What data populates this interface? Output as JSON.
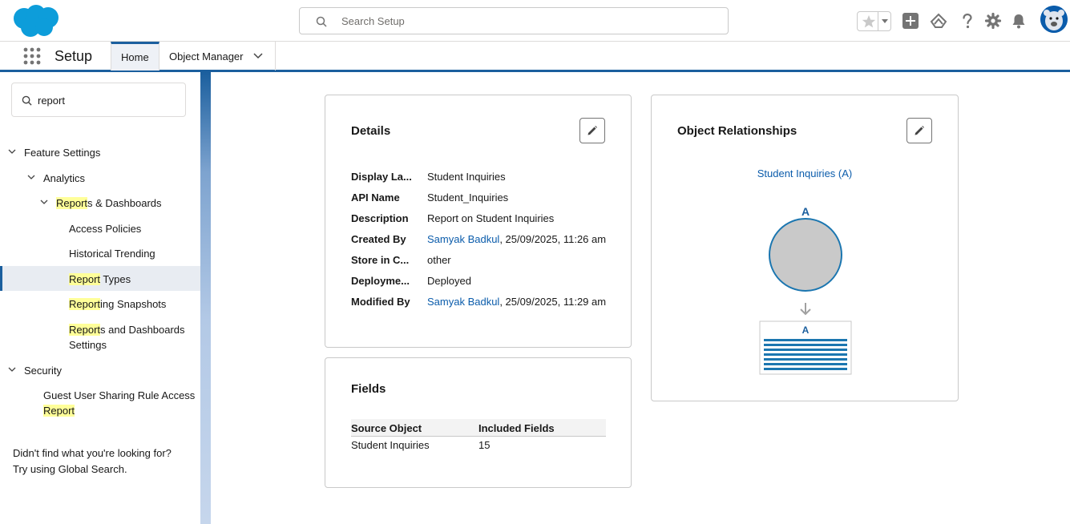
{
  "header": {
    "search_placeholder": "Search Setup"
  },
  "nav": {
    "app_name": "Setup",
    "tabs": [
      {
        "label": "Home",
        "active": true
      },
      {
        "label": "Object Manager",
        "active": false
      }
    ]
  },
  "sidebar": {
    "quickfind_value": "report",
    "tree": {
      "feature_settings": "Feature Settings",
      "analytics": "Analytics",
      "reports_dashboards": {
        "highlight": "Report",
        "rest": "s & Dashboards"
      },
      "access_policies": "Access Policies",
      "historical_trending": "Historical Trending",
      "report_types": {
        "highlight": "Report",
        "rest": " Types"
      },
      "reporting_snapshots": {
        "highlight": "Report",
        "rest": "ing Snapshots"
      },
      "reports_dash_settings": {
        "highlight": "Report",
        "rest_line1": "s and Dashboards",
        "line2": "Settings"
      },
      "security": "Security",
      "guest_user": {
        "line1": "Guest User Sharing Rule Access",
        "highlight": "Report"
      }
    },
    "help_line1": "Didn't find what you're looking for?",
    "help_line2": "Try using Global Search."
  },
  "details": {
    "title": "Details",
    "rows": [
      {
        "label": "Display La...",
        "value": "Student Inquiries"
      },
      {
        "label": "API Name",
        "value": "Student_Inquiries"
      },
      {
        "label": "Description",
        "value": "Report on Student Inquiries"
      },
      {
        "label": "Created By",
        "link": "Samyak Badkul",
        "value": ", 25/09/2025, 11:26 am"
      },
      {
        "label": "Store in C...",
        "value": "other"
      },
      {
        "label": "Deployme...",
        "value": "Deployed"
      },
      {
        "label": "Modified By",
        "link": "Samyak Badkul",
        "value": ", 25/09/2025, 11:29 am"
      }
    ]
  },
  "fields": {
    "title": "Fields",
    "columns": [
      "Source Object",
      "Included Fields"
    ],
    "rows": [
      {
        "source_object": "Student Inquiries",
        "included_fields": "15"
      }
    ]
  },
  "relationships": {
    "title": "Object Relationships",
    "link": "Student Inquiries (A)",
    "circle_label": "A",
    "table_label": "A"
  },
  "colors": {
    "brand_blue": "#1b5f9e",
    "link_blue": "#0b5cab",
    "highlight": "#ffff99",
    "logo_blue": "#0d9dda"
  }
}
